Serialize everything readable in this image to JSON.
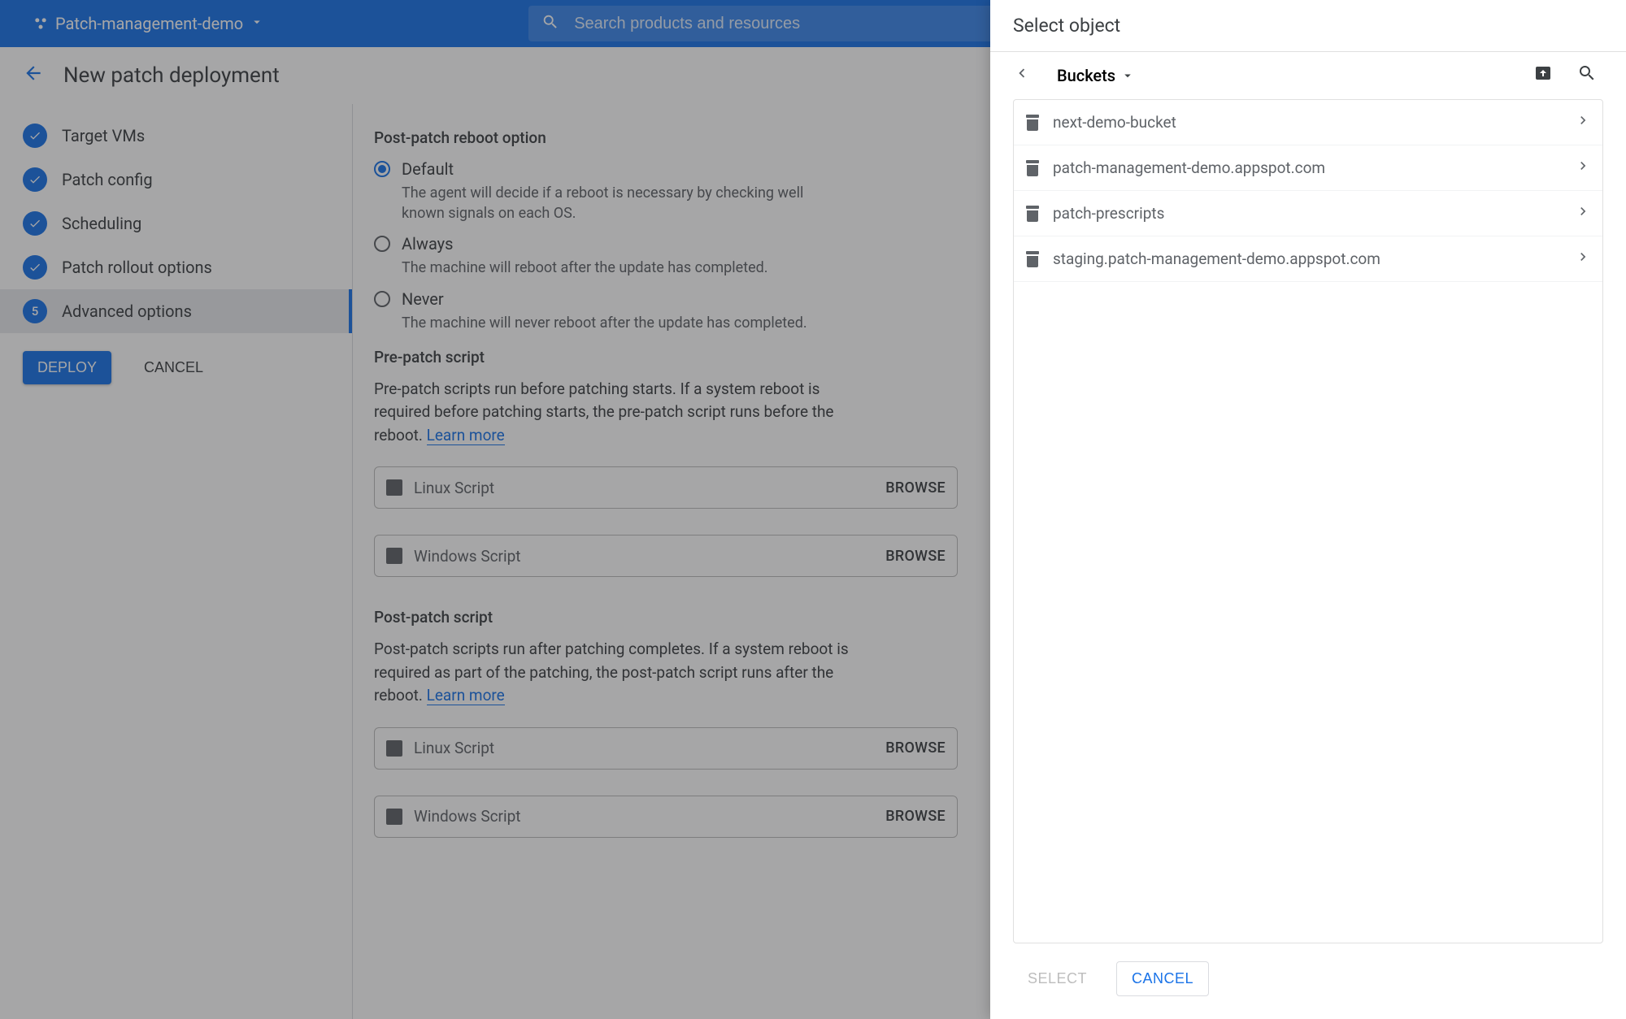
{
  "header": {
    "project": "Patch-management-demo",
    "search_placeholder": "Search products and resources"
  },
  "page": {
    "title": "New patch deployment"
  },
  "sidebar": {
    "steps": [
      {
        "label": "Target VMs",
        "done": true
      },
      {
        "label": "Patch config",
        "done": true
      },
      {
        "label": "Scheduling",
        "done": true
      },
      {
        "label": "Patch rollout options",
        "done": true
      },
      {
        "label": "Advanced options",
        "active": true,
        "number": "5"
      }
    ],
    "deploy": "DEPLOY",
    "cancel": "CANCEL"
  },
  "main": {
    "reboot_section": {
      "title": "Post-patch reboot option",
      "options": [
        {
          "label": "Default",
          "desc": "The agent will decide if a reboot is necessary by checking well known signals on each OS.",
          "selected": true
        },
        {
          "label": "Always",
          "desc": "The machine will reboot after the update has completed."
        },
        {
          "label": "Never",
          "desc": "The machine will never reboot after the update has completed."
        }
      ]
    },
    "pre_patch": {
      "title": "Pre-patch script",
      "desc": "Pre-patch scripts run before patching starts. If a system reboot is required before patching starts, the pre-patch script runs before the reboot. ",
      "learn_more": "Learn more",
      "linux": "Linux Script",
      "windows": "Windows Script",
      "browse": "BROWSE"
    },
    "post_patch": {
      "title": "Post-patch script",
      "desc": "Post-patch scripts run after patching completes. If a system reboot is required as part of the patching, the post-patch script runs after the reboot. ",
      "learn_more": "Learn more"
    }
  },
  "panel": {
    "title": "Select object",
    "breadcrumb": "Buckets",
    "buckets": [
      "next-demo-bucket",
      "patch-management-demo.appspot.com",
      "patch-prescripts",
      "staging.patch-management-demo.appspot.com"
    ],
    "select": "SELECT",
    "cancel": "CANCEL"
  }
}
